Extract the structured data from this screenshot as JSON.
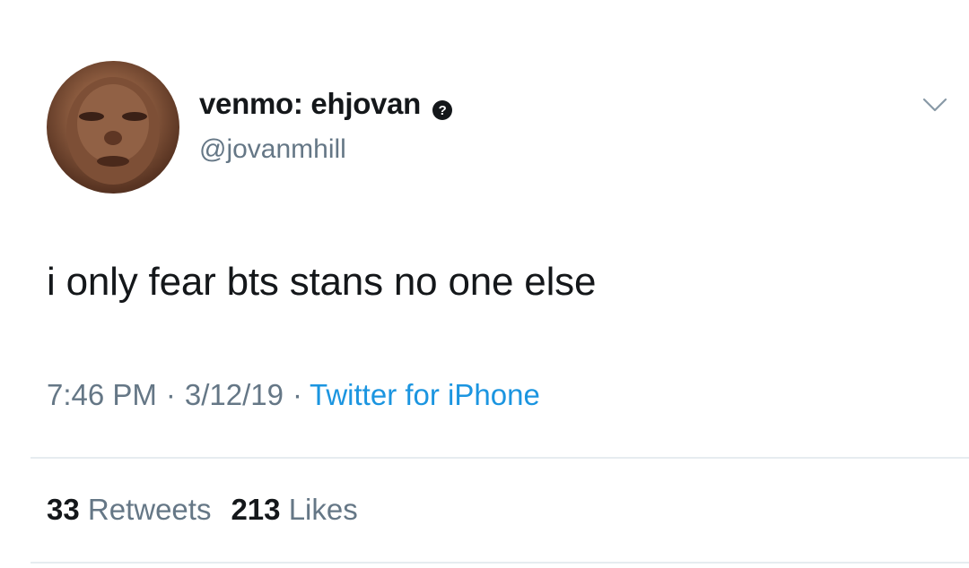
{
  "author": {
    "display_name": "venmo: ehjovan",
    "handle": "@jovanmhill",
    "verified_badge_icon": "question-circle-icon"
  },
  "tweet": {
    "text": "i only fear bts stans no one else",
    "time": "7:46 PM",
    "date": "3/12/19",
    "separator": "·",
    "source": "Twitter for iPhone"
  },
  "stats": {
    "retweets_count": "33",
    "retweets_label": "Retweets",
    "likes_count": "213",
    "likes_label": "Likes"
  },
  "icons": {
    "menu": "chevron-down-icon"
  },
  "colors": {
    "text": "#14171a",
    "secondary_text": "#657786",
    "link": "#1b95e0",
    "divider": "#e6ecf0"
  }
}
